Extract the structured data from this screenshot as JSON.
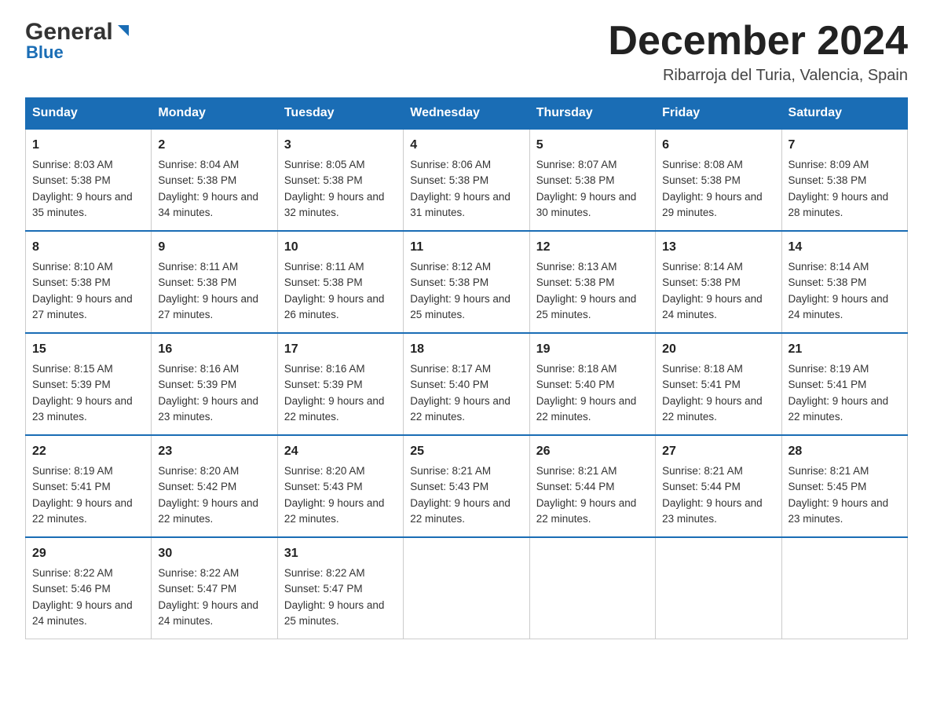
{
  "header": {
    "logo_general": "General",
    "logo_blue": "Blue",
    "month_title": "December 2024",
    "location": "Ribarroja del Turia, Valencia, Spain"
  },
  "columns": [
    "Sunday",
    "Monday",
    "Tuesday",
    "Wednesday",
    "Thursday",
    "Friday",
    "Saturday"
  ],
  "weeks": [
    [
      {
        "day": "1",
        "sunrise": "Sunrise: 8:03 AM",
        "sunset": "Sunset: 5:38 PM",
        "daylight": "Daylight: 9 hours and 35 minutes."
      },
      {
        "day": "2",
        "sunrise": "Sunrise: 8:04 AM",
        "sunset": "Sunset: 5:38 PM",
        "daylight": "Daylight: 9 hours and 34 minutes."
      },
      {
        "day": "3",
        "sunrise": "Sunrise: 8:05 AM",
        "sunset": "Sunset: 5:38 PM",
        "daylight": "Daylight: 9 hours and 32 minutes."
      },
      {
        "day": "4",
        "sunrise": "Sunrise: 8:06 AM",
        "sunset": "Sunset: 5:38 PM",
        "daylight": "Daylight: 9 hours and 31 minutes."
      },
      {
        "day": "5",
        "sunrise": "Sunrise: 8:07 AM",
        "sunset": "Sunset: 5:38 PM",
        "daylight": "Daylight: 9 hours and 30 minutes."
      },
      {
        "day": "6",
        "sunrise": "Sunrise: 8:08 AM",
        "sunset": "Sunset: 5:38 PM",
        "daylight": "Daylight: 9 hours and 29 minutes."
      },
      {
        "day": "7",
        "sunrise": "Sunrise: 8:09 AM",
        "sunset": "Sunset: 5:38 PM",
        "daylight": "Daylight: 9 hours and 28 minutes."
      }
    ],
    [
      {
        "day": "8",
        "sunrise": "Sunrise: 8:10 AM",
        "sunset": "Sunset: 5:38 PM",
        "daylight": "Daylight: 9 hours and 27 minutes."
      },
      {
        "day": "9",
        "sunrise": "Sunrise: 8:11 AM",
        "sunset": "Sunset: 5:38 PM",
        "daylight": "Daylight: 9 hours and 27 minutes."
      },
      {
        "day": "10",
        "sunrise": "Sunrise: 8:11 AM",
        "sunset": "Sunset: 5:38 PM",
        "daylight": "Daylight: 9 hours and 26 minutes."
      },
      {
        "day": "11",
        "sunrise": "Sunrise: 8:12 AM",
        "sunset": "Sunset: 5:38 PM",
        "daylight": "Daylight: 9 hours and 25 minutes."
      },
      {
        "day": "12",
        "sunrise": "Sunrise: 8:13 AM",
        "sunset": "Sunset: 5:38 PM",
        "daylight": "Daylight: 9 hours and 25 minutes."
      },
      {
        "day": "13",
        "sunrise": "Sunrise: 8:14 AM",
        "sunset": "Sunset: 5:38 PM",
        "daylight": "Daylight: 9 hours and 24 minutes."
      },
      {
        "day": "14",
        "sunrise": "Sunrise: 8:14 AM",
        "sunset": "Sunset: 5:38 PM",
        "daylight": "Daylight: 9 hours and 24 minutes."
      }
    ],
    [
      {
        "day": "15",
        "sunrise": "Sunrise: 8:15 AM",
        "sunset": "Sunset: 5:39 PM",
        "daylight": "Daylight: 9 hours and 23 minutes."
      },
      {
        "day": "16",
        "sunrise": "Sunrise: 8:16 AM",
        "sunset": "Sunset: 5:39 PM",
        "daylight": "Daylight: 9 hours and 23 minutes."
      },
      {
        "day": "17",
        "sunrise": "Sunrise: 8:16 AM",
        "sunset": "Sunset: 5:39 PM",
        "daylight": "Daylight: 9 hours and 22 minutes."
      },
      {
        "day": "18",
        "sunrise": "Sunrise: 8:17 AM",
        "sunset": "Sunset: 5:40 PM",
        "daylight": "Daylight: 9 hours and 22 minutes."
      },
      {
        "day": "19",
        "sunrise": "Sunrise: 8:18 AM",
        "sunset": "Sunset: 5:40 PM",
        "daylight": "Daylight: 9 hours and 22 minutes."
      },
      {
        "day": "20",
        "sunrise": "Sunrise: 8:18 AM",
        "sunset": "Sunset: 5:41 PM",
        "daylight": "Daylight: 9 hours and 22 minutes."
      },
      {
        "day": "21",
        "sunrise": "Sunrise: 8:19 AM",
        "sunset": "Sunset: 5:41 PM",
        "daylight": "Daylight: 9 hours and 22 minutes."
      }
    ],
    [
      {
        "day": "22",
        "sunrise": "Sunrise: 8:19 AM",
        "sunset": "Sunset: 5:41 PM",
        "daylight": "Daylight: 9 hours and 22 minutes."
      },
      {
        "day": "23",
        "sunrise": "Sunrise: 8:20 AM",
        "sunset": "Sunset: 5:42 PM",
        "daylight": "Daylight: 9 hours and 22 minutes."
      },
      {
        "day": "24",
        "sunrise": "Sunrise: 8:20 AM",
        "sunset": "Sunset: 5:43 PM",
        "daylight": "Daylight: 9 hours and 22 minutes."
      },
      {
        "day": "25",
        "sunrise": "Sunrise: 8:21 AM",
        "sunset": "Sunset: 5:43 PM",
        "daylight": "Daylight: 9 hours and 22 minutes."
      },
      {
        "day": "26",
        "sunrise": "Sunrise: 8:21 AM",
        "sunset": "Sunset: 5:44 PM",
        "daylight": "Daylight: 9 hours and 22 minutes."
      },
      {
        "day": "27",
        "sunrise": "Sunrise: 8:21 AM",
        "sunset": "Sunset: 5:44 PM",
        "daylight": "Daylight: 9 hours and 23 minutes."
      },
      {
        "day": "28",
        "sunrise": "Sunrise: 8:21 AM",
        "sunset": "Sunset: 5:45 PM",
        "daylight": "Daylight: 9 hours and 23 minutes."
      }
    ],
    [
      {
        "day": "29",
        "sunrise": "Sunrise: 8:22 AM",
        "sunset": "Sunset: 5:46 PM",
        "daylight": "Daylight: 9 hours and 24 minutes."
      },
      {
        "day": "30",
        "sunrise": "Sunrise: 8:22 AM",
        "sunset": "Sunset: 5:47 PM",
        "daylight": "Daylight: 9 hours and 24 minutes."
      },
      {
        "day": "31",
        "sunrise": "Sunrise: 8:22 AM",
        "sunset": "Sunset: 5:47 PM",
        "daylight": "Daylight: 9 hours and 25 minutes."
      },
      null,
      null,
      null,
      null
    ]
  ]
}
